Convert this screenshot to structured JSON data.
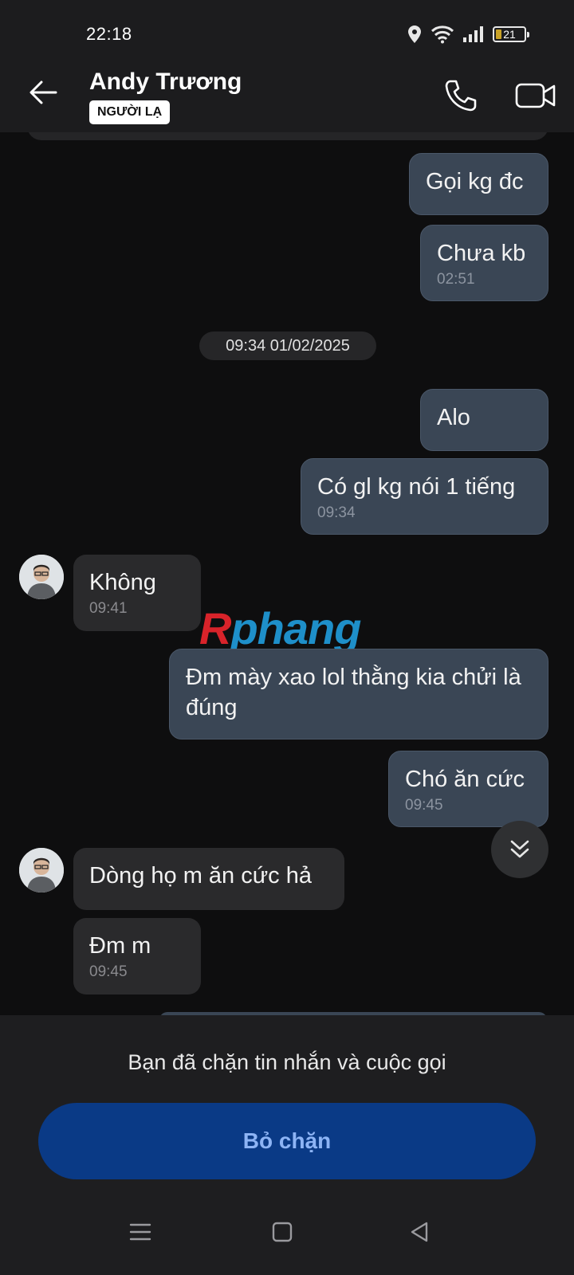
{
  "status_bar": {
    "time": "22:18",
    "battery": "21",
    "battery_level": 0.21
  },
  "header": {
    "contact_name": "Andy Trương",
    "badge": "NGƯỜI LẠ"
  },
  "messages": [
    {
      "side": "out",
      "text": "Gọi kg đc",
      "time": ""
    },
    {
      "side": "out",
      "text": "Chưa kb",
      "time": "02:51"
    },
    {
      "side": "out",
      "text": "Alo",
      "time": ""
    },
    {
      "side": "out",
      "text": "Có gl kg nói 1 tiếng",
      "time": "09:34"
    },
    {
      "side": "in",
      "text": "Không",
      "time": "09:41"
    },
    {
      "side": "out",
      "text": "Đm mày xao lol thằng kia chửi là đúng",
      "time": ""
    },
    {
      "side": "out",
      "text": "Chó ăn cức",
      "time": "09:45"
    },
    {
      "side": "in",
      "text": "Dòng họ m ăn cức hả",
      "time": ""
    },
    {
      "side": "in",
      "text": "Đm m",
      "time": "09:45"
    }
  ],
  "date_separator": "09:34 01/02/2025",
  "watermark": {
    "first": "R",
    "rest": "phang"
  },
  "blocked": {
    "message": "Bạn đã chặn tin nhắn và cuộc gọi",
    "unblock_label": "Bỏ chặn"
  },
  "icons": {
    "back": "back-arrow-icon",
    "call": "phone-icon",
    "video": "video-camera-icon",
    "scroll": "double-chevron-down-icon",
    "nav_menu": "menu-icon",
    "nav_home": "home-icon",
    "nav_back": "nav-back-icon"
  },
  "colors": {
    "outgoing_bubble": "#3a4655",
    "incoming_bubble": "#2a2a2c",
    "unblock_button": "#0a3a86",
    "unblock_text": "#8db4f5"
  }
}
